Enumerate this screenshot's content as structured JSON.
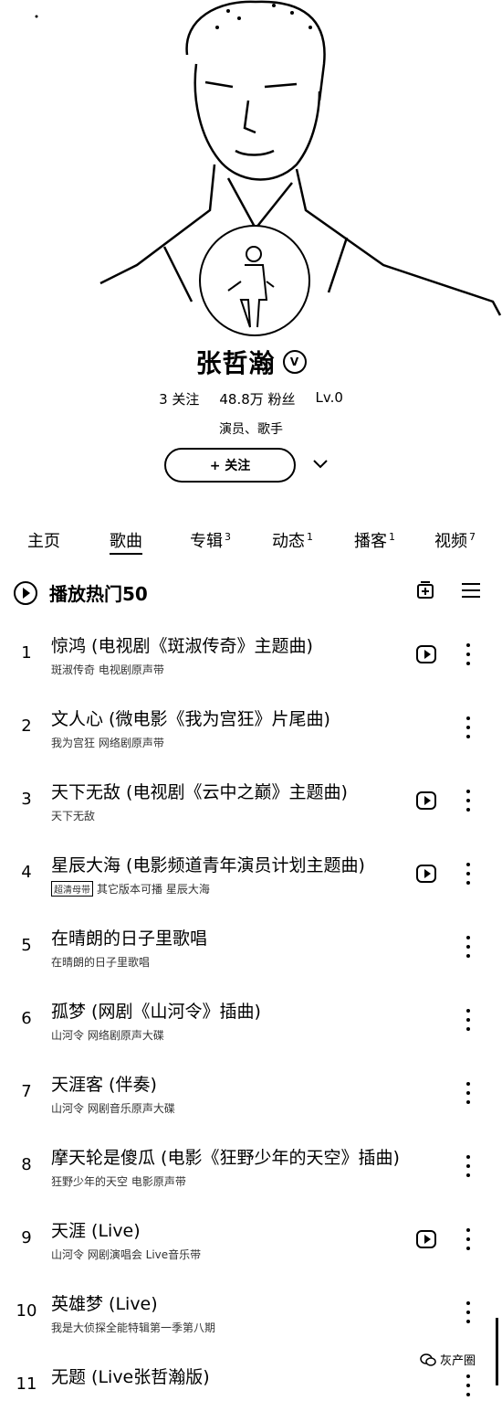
{
  "profile": {
    "name": "张哲瀚",
    "verified_symbol": "V",
    "following": "3 关注",
    "fans": "48.8万 粉丝",
    "level": "Lv.0",
    "bio": "演员、歌手",
    "follow_label": "+ 关注"
  },
  "tabs": [
    {
      "label": "主页",
      "count": ""
    },
    {
      "label": "歌曲",
      "count": ""
    },
    {
      "label": "专辑",
      "count": "3"
    },
    {
      "label": "动态",
      "count": "1"
    },
    {
      "label": "播客",
      "count": "1"
    },
    {
      "label": "视频",
      "count": "7"
    }
  ],
  "section": {
    "title": "播放热门50"
  },
  "songs": [
    {
      "index": "1",
      "title": "惊鸿 (电视剧《斑淑传奇》主题曲)",
      "sub": "斑淑传奇 电视剧原声带",
      "tag": "",
      "mv": true
    },
    {
      "index": "2",
      "title": "文人心 (微电影《我为宫狂》片尾曲)",
      "sub": "我为宫狂 网络剧原声带",
      "tag": "",
      "mv": false
    },
    {
      "index": "3",
      "title": "天下无敌 (电视剧《云中之巅》主题曲)",
      "sub": "天下无敌",
      "tag": "",
      "mv": true
    },
    {
      "index": "4",
      "title": "星辰大海 (电影频道青年演员计划主题曲)",
      "sub": "其它版本可播  星辰大海",
      "tag": "超清母带",
      "mv": true
    },
    {
      "index": "5",
      "title": "在晴朗的日子里歌唱",
      "sub": "在晴朗的日子里歌唱",
      "tag": "",
      "mv": false
    },
    {
      "index": "6",
      "title": "孤梦 (网剧《山河令》插曲)",
      "sub": "山河令 网络剧原声大碟",
      "tag": "",
      "mv": false
    },
    {
      "index": "7",
      "title": "天涯客 (伴奏)",
      "sub": "山河令 网剧音乐原声大碟",
      "tag": "",
      "mv": false
    },
    {
      "index": "8",
      "title": "摩天轮是傻瓜 (电影《狂野少年的天空》插曲)",
      "sub": "狂野少年的天空 电影原声带",
      "tag": "",
      "mv": false
    },
    {
      "index": "9",
      "title": "天涯 (Live)",
      "sub": "山河令 网剧演唱会 Live音乐带",
      "tag": "",
      "mv": true
    },
    {
      "index": "10",
      "title": "英雄梦 (Live)",
      "sub": "我是大侦探全能特辑第一季第八期",
      "tag": "",
      "mv": false
    },
    {
      "index": "11",
      "title": "无题 (Live张哲瀚版)",
      "sub": "",
      "tag": "",
      "mv": false
    }
  ],
  "watermark": "灰产圈"
}
